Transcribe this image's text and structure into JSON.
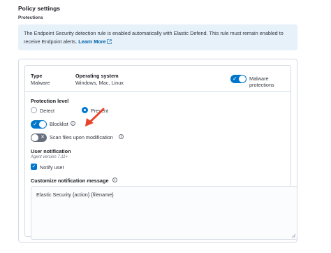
{
  "header": {
    "title": "Policy settings",
    "section": "Protections"
  },
  "callout": {
    "text": "The Endpoint Security detection rule is enabled automatically with Elastic Defend. This rule must remain enabled to receive Endpoint alerts.",
    "link": "Learn More"
  },
  "card": {
    "type_label": "Type",
    "type_value": "Malware",
    "os_label": "Operating system",
    "os_value": "Windows, Mac, Linux",
    "toggle_label": "Malware protections",
    "toggle_on": true
  },
  "protection": {
    "title": "Protection level",
    "options": [
      {
        "label": "Detect",
        "selected": false
      },
      {
        "label": "Prevent",
        "selected": true
      }
    ],
    "blocklist_label": "Blocklist",
    "blocklist_on": true,
    "scan_label": "Scan files upon modification",
    "scan_on": false
  },
  "notification": {
    "title": "User notification",
    "version": "Agent version 7.11+",
    "notify_label": "Notify user",
    "notify_checked": true,
    "customize_label": "Customize notification message",
    "message": "Elastic Security {action} {filename}"
  },
  "colors": {
    "accent": "#0077cc",
    "callout_bg": "#e6f1fa",
    "annotation_arrow": "#e8442a"
  }
}
